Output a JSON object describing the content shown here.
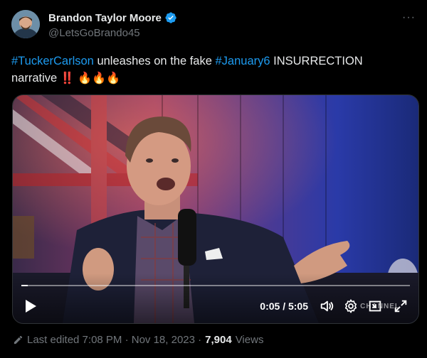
{
  "author": {
    "display_name": "Brandon Taylor Moore",
    "handle": "@LetsGoBrando45"
  },
  "tweet": {
    "hashtag1": "#TuckerCarlson",
    "text1": " unleashes on the fake ",
    "hashtag2": "#January6",
    "text2": " INSURRECTION",
    "text3": "narrative",
    "bang": "‼️",
    "fire": "🔥🔥🔥"
  },
  "video": {
    "time_display": "0:05 / 5:05",
    "progress": 0.016,
    "watermark": "CHANNEL"
  },
  "meta": {
    "edited_label": "Last edited 7:08 PM · Nov 18, 2023 ·",
    "views_count": "7,904",
    "views_label": "Views"
  },
  "more_label": "···",
  "colors": {
    "accent": "#1d9bf0",
    "verified": "#1d9bf0",
    "muted": "#71767b",
    "background": "#000000"
  },
  "icons": [
    "verified-badge-icon",
    "more-icon",
    "play-icon",
    "volume-icon",
    "settings-icon",
    "fullscreen-icon",
    "pencil-icon"
  ]
}
